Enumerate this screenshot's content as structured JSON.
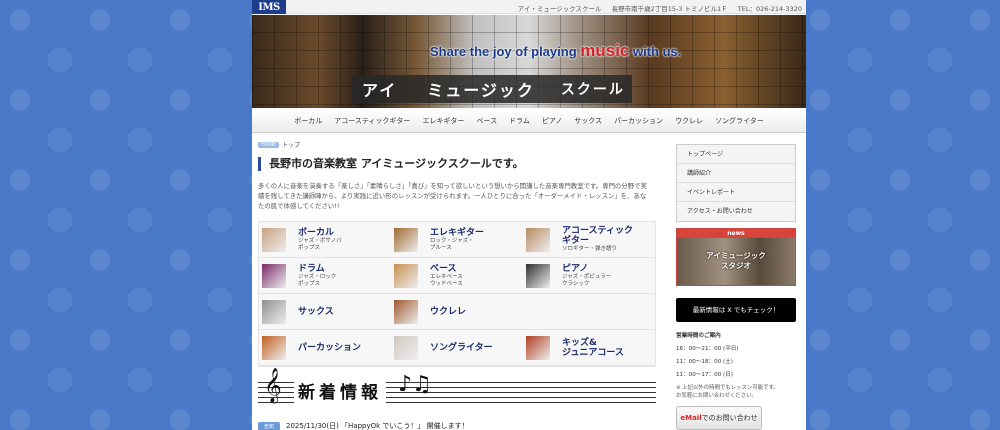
{
  "header": {
    "logo_text": "IMS",
    "school_name": "アイ・ミュージックスクール",
    "address": "長野市南千歳2丁目15-3 トミノビル1Ｆ",
    "tel": "TEL：026-214-3320"
  },
  "banner": {
    "slogan_pre": "Share the joy of playing ",
    "slogan_music": "music",
    "slogan_post": " with us.",
    "name_a": "アイ",
    "name_b": "ミュージック",
    "name_c": "スクール"
  },
  "nav": [
    "ボーカル",
    "アコースティックギター",
    "エレキギター",
    "ベース",
    "ドラム",
    "ピアノ",
    "サックス",
    "パーカッション",
    "ウクレレ",
    "ソングライター"
  ],
  "breadcrumb": {
    "home_label": "HOME",
    "current": "トップ"
  },
  "main": {
    "title": "長野市の音楽教室 アイミュージックスクールです。",
    "intro": "多くの人に音楽を演奏する「楽しさ」「素晴らしさ」「喜び」を知って欲しいという想いから開講した音楽専門教室です。専門の分野で実績を残してきた講師陣から、より実践に近い形のレッスンが受けられます。一人ひとりに合った「オーダーメイド・レッスン」を、あなたの肌で体感してください!!"
  },
  "courses": [
    {
      "name": "ボーカル",
      "sub": "ジャズ・ポサノバ\nポップス",
      "color": "#c8a080"
    },
    {
      "name": "エレキギター",
      "sub": "ロック・ジャズ・\nブルース",
      "color": "#a06a30"
    },
    {
      "name": "アコースティック\nギター",
      "sub": "ソロギター・弾き語り",
      "color": "#b88a60"
    },
    {
      "name": "ドラム",
      "sub": "ジャズ・ロック\nポップス",
      "color": "#7a2a6a"
    },
    {
      "name": "ベース",
      "sub": "エレキベース\nウッドベース",
      "color": "#c89050"
    },
    {
      "name": "ピアノ",
      "sub": "ジャズ・ポピュラー\nクラシック",
      "color": "#303030"
    },
    {
      "name": "サックス",
      "sub": "",
      "color": "#909090"
    },
    {
      "name": "ウクレレ",
      "sub": "",
      "color": "#a05a30"
    },
    {
      "name": "",
      "sub": "",
      "color": ""
    },
    {
      "name": "パーカッション",
      "sub": "",
      "color": "#c06020"
    },
    {
      "name": "ソングライター",
      "sub": "",
      "color": "#d0c8c0"
    },
    {
      "name": "キッズ&\nジュニアコース",
      "sub": "",
      "color": "#b04020"
    }
  ],
  "news": {
    "heading": "新着情報",
    "tag": "告知",
    "first_item": "2025/11/30(日) 「HappyOk でいこう！」 開催します！"
  },
  "sidebar": {
    "menu": [
      "トップページ",
      "講師紹介",
      "イベントレポート",
      "アクセス・お問い合わせ"
    ],
    "studio_badge": "news",
    "studio_text": "アイミュージック\nスタジオ",
    "x_button": "最新情報は X でもチェック！",
    "hours_title": "営業時間のご案内",
    "hours": [
      "16：00～21：00 (平日)",
      "11：00～18：00 (土)",
      "11：00～17：00 (日)"
    ],
    "note": "※ 上記以外の時間でもレッスン可能です。\nお気軽にお問い合わせください。",
    "mail_em": "eMail",
    "mail_rest": "でのお問い合わせ"
  }
}
